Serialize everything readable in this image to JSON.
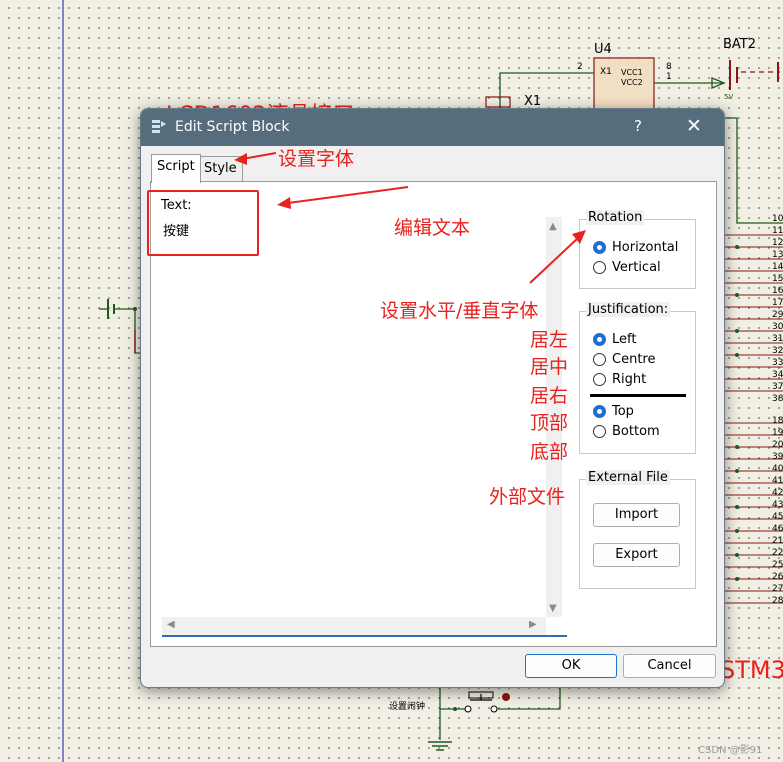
{
  "schematic": {
    "u4_label": "U4",
    "u4_pin_x1": "X1",
    "u4_pin_vcc1": "VCC1",
    "u4_pin_vcc2": "VCC2",
    "u4_pin_num_2": "2",
    "u4_pin_num_8": "8",
    "u4_pin_num_1": "1",
    "x1_label": "X1",
    "bat2_label": "BAT2",
    "bat2_volt": "5V",
    "lcd_title_partial": "LCD1602液晶接口",
    "stm_label_partial": "STM3",
    "switch_label": "设置闹钟",
    "right_pins_top": [
      "10",
      "11",
      "12",
      "13",
      "14",
      "15",
      "16",
      "17",
      "29",
      "30",
      "31",
      "32",
      "33",
      "34",
      "37",
      "38"
    ],
    "right_pins_bottom": [
      "18",
      "19",
      "20",
      "39",
      "40",
      "41",
      "42",
      "43",
      "45",
      "46",
      "21",
      "22",
      "25",
      "26",
      "27",
      "28"
    ]
  },
  "dialog": {
    "title": "Edit Script Block",
    "help": "?",
    "close": "✕",
    "tabs": [
      "Script",
      "Style"
    ],
    "text_label": "Text:",
    "text_value": "按键",
    "rotation": {
      "label": "Rotation",
      "options": [
        "Horizontal",
        "Vertical"
      ],
      "selected": "Horizontal"
    },
    "justification": {
      "label": "Justification:",
      "horizontal_options": [
        "Left",
        "Centre",
        "Right"
      ],
      "horizontal_selected": "Left",
      "vertical_options": [
        "Top",
        "Bottom"
      ],
      "vertical_selected": "Top"
    },
    "external_file": {
      "label": "External File",
      "import": "Import",
      "export": "Export"
    },
    "ok": "OK",
    "cancel": "Cancel"
  },
  "annotations": {
    "set_font": "设置字体",
    "edit_text": "编辑文本",
    "set_orientation": "设置水平/垂直字体",
    "left": "居左",
    "center": "居中",
    "right": "居右",
    "top": "顶部",
    "bottom": "底部",
    "external_file": "外部文件"
  },
  "watermark": "CSDN @影91",
  "colors": {
    "titlebar": "#566d7d",
    "accent": "#1f6fd1",
    "annotation": "#e8231f",
    "wire": "#1f5a1f",
    "component_red": "#8b1414"
  }
}
